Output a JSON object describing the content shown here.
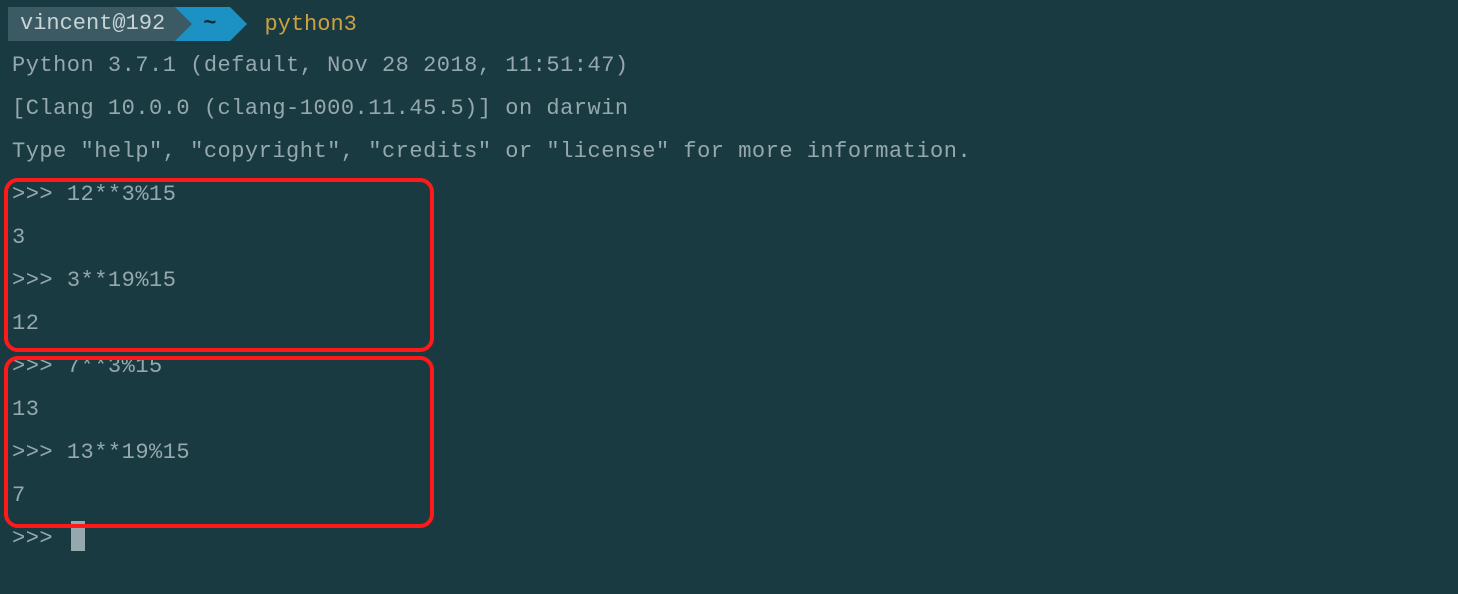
{
  "prompt": {
    "user_host": "vincent@192",
    "path": "~",
    "command": "python3"
  },
  "header": {
    "line1": "Python 3.7.1 (default, Nov 28 2018, 11:51:47)",
    "line2": "[Clang 10.0.0 (clang-1000.11.45.5)] on darwin",
    "line3": "Type \"help\", \"copyright\", \"credits\" or \"license\" for more information."
  },
  "repl": {
    "prompt": ">>> ",
    "entries": [
      {
        "input": "12**3%15",
        "output": "3"
      },
      {
        "input": "3**19%15",
        "output": "12"
      },
      {
        "input": "7**3%15",
        "output": "13"
      },
      {
        "input": "13**19%15",
        "output": "7"
      }
    ]
  }
}
